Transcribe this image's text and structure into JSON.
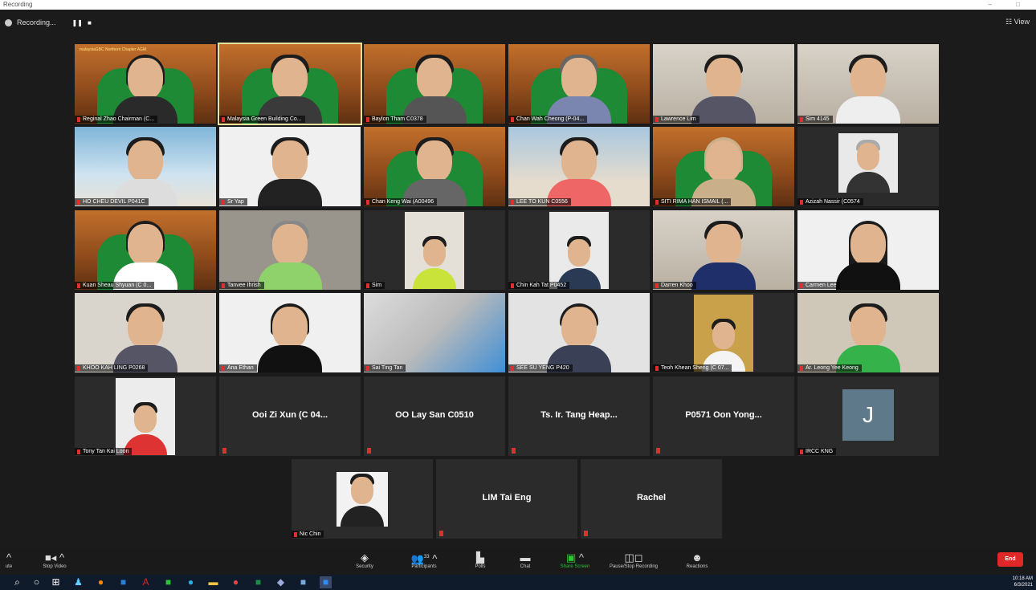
{
  "window": {
    "title": "Recording",
    "controls": "– □"
  },
  "recording": {
    "label": "Recording...",
    "pause": "❚❚",
    "stop": "■"
  },
  "view_button": {
    "label": "View"
  },
  "tiles": [
    {
      "name": "Reginal Zhao  Chairman (C..."
    },
    {
      "name": "Malaysia Green Building Co..."
    },
    {
      "name": "Baylon Tham C0378"
    },
    {
      "name": "Chan Wah Cheong (P-04..."
    },
    {
      "name": "Lawrence Lim"
    },
    {
      "name": "Sim 4145"
    },
    {
      "name": "HO CHEU DEVIL P041C"
    },
    {
      "name": "Sr Yap"
    },
    {
      "name": "Chan Keng Wai (A00496"
    },
    {
      "name": "LEE TO KUN C0556"
    },
    {
      "name": "SITI RIMA HAN ISMAIL (..."
    },
    {
      "name": "Azizah Nassir (C0574"
    },
    {
      "name": "Kuan Sheau Shyuan (C 0..."
    },
    {
      "name": "Tanvee Ihrish"
    },
    {
      "name": "Sim"
    },
    {
      "name": "Chin Kah Tat P0452"
    },
    {
      "name": "Darren Khoo"
    },
    {
      "name": "Carmen Lee"
    },
    {
      "name": "KHOO KAH LING P0268"
    },
    {
      "name": "Ana Ethan"
    },
    {
      "name": "Sai Ting Tan"
    },
    {
      "name": "SEE SU YENG P420"
    },
    {
      "name": "Teoh Khean Sheng (C 07..."
    },
    {
      "name": "Ar. Leong Yee Keong"
    },
    {
      "name": "Tony Tan Kai Loon"
    },
    {
      "bigname": "Ooi Zi Xun (C 04..."
    },
    {
      "bigname": "OO Lay San C0510"
    },
    {
      "bigname": "Ts. Ir. Tang Heap..."
    },
    {
      "bigname": "P0571 Oon Yong..."
    },
    {
      "name": "IRCC KNG",
      "avatar": "J"
    },
    {
      "name": "Nic Chin"
    },
    {
      "bigname": "LIM Tai Eng"
    },
    {
      "bigname": "Rachel"
    }
  ],
  "brand_text": "malaysiaGBC Northern Chapter AGM",
  "toolbar": {
    "unmute": "ute",
    "stop_video": "Stop Video",
    "security": "Security",
    "participants": "Participants",
    "participants_count": "33",
    "polls": "Polls",
    "chat": "Chat",
    "share_screen": "Share Screen",
    "pause_recording": "Pause/Stop Recording",
    "reactions": "Reactions",
    "end": "End"
  },
  "taskbar": {
    "time": "10:18 AM",
    "date": "6/3/2021"
  },
  "icons": {
    "start": "windows-start-icon",
    "search": "search-icon"
  }
}
